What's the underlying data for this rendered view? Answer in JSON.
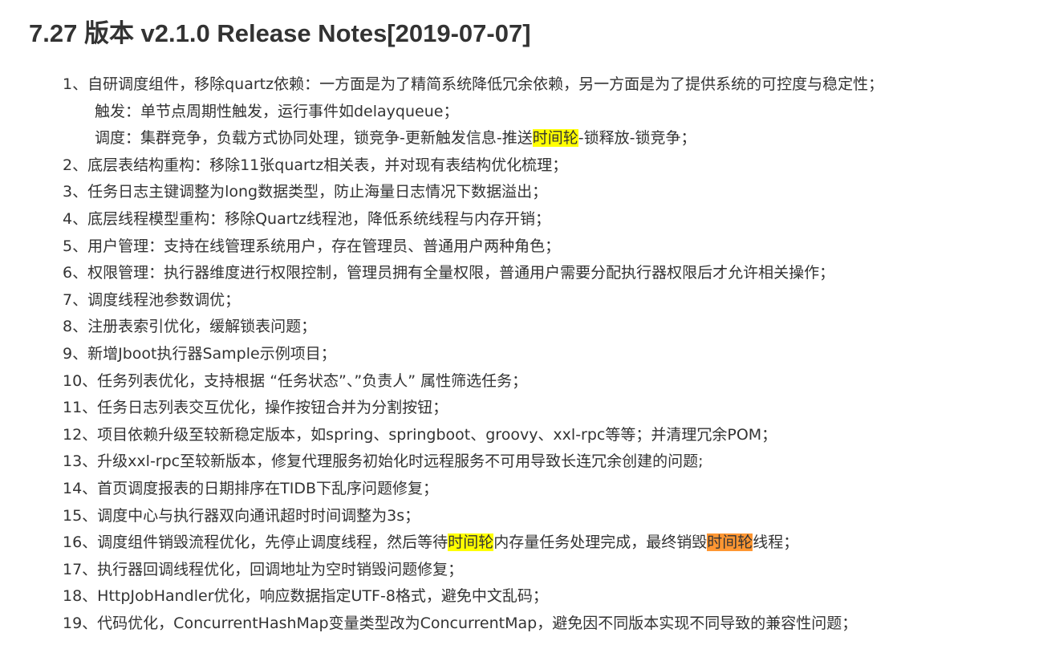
{
  "document": {
    "title": "7.27 版本 v2.1.0 Release Notes[2019-07-07]",
    "highlight_colors": {
      "primary": "#ffff00",
      "current_match": "#ff9632"
    },
    "lines": [
      {
        "id": "l1",
        "segments": [
          {
            "text": "1、自研调度组件，移除quartz依赖：一方面是为了精简系统降低冗余依赖，另一方面是为了提供系统的可控度与稳定性；"
          }
        ]
      },
      {
        "id": "l1a",
        "segments": [
          {
            "text": "触发：单节点周期性触发，运行事件如delayqueue；"
          }
        ]
      },
      {
        "id": "l1b",
        "segments": [
          {
            "text": "调度：集群竞争，负载方式协同处理，锁竞争-更新触发信息-推送"
          },
          {
            "text": "时间轮"
          },
          {
            "text": "-锁释放-锁竞争；"
          }
        ]
      },
      {
        "id": "l2",
        "segments": [
          {
            "text": "2、底层表结构重构：移除11张quartz相关表，并对现有表结构优化梳理；"
          }
        ]
      },
      {
        "id": "l3",
        "segments": [
          {
            "text": "3、任务日志主键调整为long数据类型，防止海量日志情况下数据溢出；"
          }
        ]
      },
      {
        "id": "l4",
        "segments": [
          {
            "text": "4、底层线程模型重构：移除Quartz线程池，降低系统线程与内存开销；"
          }
        ]
      },
      {
        "id": "l5",
        "segments": [
          {
            "text": "5、用户管理：支持在线管理系统用户，存在管理员、普通用户两种角色；"
          }
        ]
      },
      {
        "id": "l6",
        "segments": [
          {
            "text": "6、权限管理：执行器维度进行权限控制，管理员拥有全量权限，普通用户需要分配执行器权限后才允许相关操作；"
          }
        ]
      },
      {
        "id": "l7",
        "segments": [
          {
            "text": "7、调度线程池参数调优；"
          }
        ]
      },
      {
        "id": "l8",
        "segments": [
          {
            "text": "8、注册表索引优化，缓解锁表问题；"
          }
        ]
      },
      {
        "id": "l9",
        "segments": [
          {
            "text": "9、新增Jboot执行器Sample示例项目；"
          }
        ]
      },
      {
        "id": "l10",
        "segments": [
          {
            "text": "10、任务列表优化，支持根据 “任务状态”、”负责人” 属性筛选任务；"
          }
        ]
      },
      {
        "id": "l11",
        "segments": [
          {
            "text": "11、任务日志列表交互优化，操作按钮合并为分割按钮；"
          }
        ]
      },
      {
        "id": "l12",
        "segments": [
          {
            "text": "12、项目依赖升级至较新稳定版本，如spring、springboot、groovy、xxl-rpc等等；并清理冗余POM；"
          }
        ]
      },
      {
        "id": "l13",
        "segments": [
          {
            "text": "13、升级xxl-rpc至较新版本，修复代理服务初始化时远程服务不可用导致长连冗余创建的问题;"
          }
        ]
      },
      {
        "id": "l14",
        "segments": [
          {
            "text": "14、首页调度报表的日期排序在TIDB下乱序问题修复；"
          }
        ]
      },
      {
        "id": "l15",
        "segments": [
          {
            "text": "15、调度中心与执行器双向通讯超时时间调整为3s；"
          }
        ]
      },
      {
        "id": "l16",
        "segments": [
          {
            "text": "16、调度组件销毁流程优化，先停止调度线程，然后等待"
          },
          {
            "text": "时间轮"
          },
          {
            "text": "内存量任务处理完成，最终销毁"
          },
          {
            "text": "时间轮"
          },
          {
            "text": "线程；"
          }
        ]
      },
      {
        "id": "l17",
        "segments": [
          {
            "text": "17、执行器回调线程优化，回调地址为空时销毁问题修复；"
          }
        ]
      },
      {
        "id": "l18",
        "segments": [
          {
            "text": "18、HttpJobHandler优化，响应数据指定UTF-8格式，避免中文乱码；"
          }
        ]
      },
      {
        "id": "l19",
        "segments": [
          {
            "text": "19、代码优化，ConcurrentHashMap变量类型改为ConcurrentMap，避免因不同版本实现不同导致的兼容性问题；"
          }
        ]
      }
    ]
  }
}
